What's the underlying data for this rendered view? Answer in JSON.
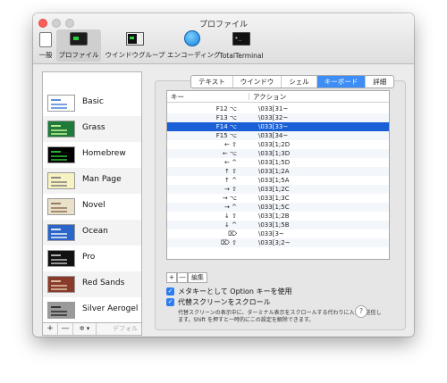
{
  "window": {
    "title": "プロファイル"
  },
  "toolbar": {
    "items": [
      {
        "label": "一般",
        "icon": "general-icon"
      },
      {
        "label": "プロファイル",
        "icon": "profiles-icon",
        "selected": true
      },
      {
        "label": "ウインドウグループ",
        "icon": "window-group-icon"
      },
      {
        "label": "エンコーディング",
        "icon": "globe-icon"
      },
      {
        "label": "TotalTerminal",
        "icon": "terminal-icon"
      }
    ]
  },
  "profiles": [
    {
      "name": "Basic",
      "bg": "#ffffff",
      "fg": "#333333"
    },
    {
      "name": "Grass",
      "bg": "#1e7a3a",
      "fg": "#d8ff9a"
    },
    {
      "name": "Homebrew",
      "bg": "#000000",
      "fg": "#2bcf3d"
    },
    {
      "name": "Man Page",
      "bg": "#f7f2c2",
      "fg": "#555555"
    },
    {
      "name": "Novel",
      "bg": "#e9e1c9",
      "fg": "#6b4b2b"
    },
    {
      "name": "Ocean",
      "bg": "#2b65c9",
      "fg": "#ffffff"
    },
    {
      "name": "Pro",
      "bg": "#111111",
      "fg": "#cccccc"
    },
    {
      "name": "Red Sands",
      "bg": "#8a3a2a",
      "fg": "#e8d3b8"
    },
    {
      "name": "Silver Aerogel",
      "bg": "#9a9a9a",
      "fg": "#222222"
    }
  ],
  "sidebar_footer": {
    "add": "+",
    "remove": "—",
    "gear": "✲ ▾",
    "default": "デフォルト"
  },
  "tabs": [
    {
      "label": "テキスト"
    },
    {
      "label": "ウインドウ"
    },
    {
      "label": "シェル"
    },
    {
      "label": "キーボード",
      "selected": true
    },
    {
      "label": "詳細"
    }
  ],
  "keyboard_table": {
    "headers": {
      "key": "キー",
      "action": "アクション"
    },
    "rows": [
      {
        "key": "F12 ⌥",
        "action": "\\033[31~"
      },
      {
        "key": "F13 ⌥",
        "action": "\\033[32~"
      },
      {
        "key": "F14 ⌥",
        "action": "\\033[33~",
        "selected": true
      },
      {
        "key": "F15 ⌥",
        "action": "\\033[34~"
      },
      {
        "key": "← ⇧",
        "action": "\\033[1;2D"
      },
      {
        "key": "← ⌥",
        "action": "\\033[1;3D"
      },
      {
        "key": "← ^",
        "action": "\\033[1;5D"
      },
      {
        "key": "↑ ⇧",
        "action": "\\033[1;2A"
      },
      {
        "key": "↑ ^",
        "action": "\\033[1;5A"
      },
      {
        "key": "→ ⇧",
        "action": "\\033[1;2C"
      },
      {
        "key": "→ ⌥",
        "action": "\\033[1;3C"
      },
      {
        "key": "→ ^",
        "action": "\\033[1;5C"
      },
      {
        "key": "↓ ⇧",
        "action": "\\033[1;2B"
      },
      {
        "key": "↓ ^",
        "action": "\\033[1;5B"
      },
      {
        "key": "⌦",
        "action": "\\033[3~"
      },
      {
        "key": "⌦ ⇧",
        "action": "\\033[3;2~"
      }
    ]
  },
  "table_controls": {
    "add": "+",
    "remove": "—",
    "edit": "編集"
  },
  "options": {
    "meta_key": {
      "label": "メタキーとして Option キーを使用",
      "checked": true
    },
    "alt_screen_scroll": {
      "label": "代替スクリーンをスクロール",
      "checked": true
    },
    "description": "代替スクリーンの表示中に、ターミナル表示をスクロールする代わりに入力を送信します。Shift を押すと一時的にこの設定を解除できます。"
  },
  "help": "?"
}
